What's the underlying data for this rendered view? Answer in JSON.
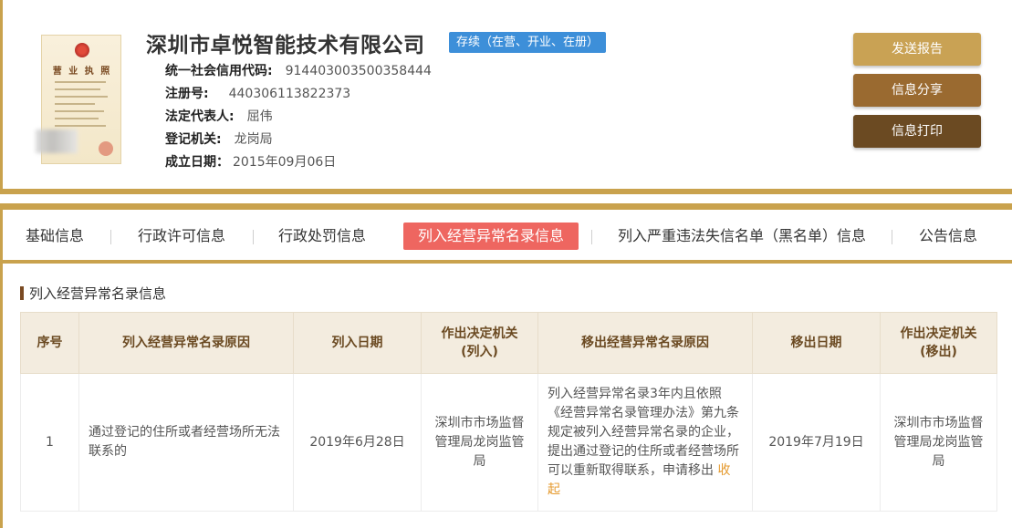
{
  "company": {
    "name": "深圳市卓悦智能技术有限公司",
    "status": "存续（在营、开业、在册）",
    "license_thumb_title": "营 业 执 照"
  },
  "info": [
    {
      "label": "统一社会信用代码:",
      "value": "914403003500358444"
    },
    {
      "label": "注册号:",
      "value": "440306113822373"
    },
    {
      "label": "法定代表人:",
      "value": "屈伟"
    },
    {
      "label": "登记机关:",
      "value": "龙岗局"
    },
    {
      "label": "成立日期：",
      "value": "2015年09月06日"
    }
  ],
  "actions": {
    "send": "发送报告",
    "share": "信息分享",
    "print": "信息打印"
  },
  "tabs": [
    {
      "label": "基础信息"
    },
    {
      "label": "行政许可信息"
    },
    {
      "label": "行政处罚信息"
    },
    {
      "label": "列入经营异常名录信息"
    },
    {
      "label": "列入严重违法失信名单（黑名单）信息"
    },
    {
      "label": "公告信息"
    }
  ],
  "active_tab": "列入经营异常名录信息",
  "section_title": "列入经营异常名录信息",
  "table": {
    "headers": [
      "序号",
      "列入经营异常名录原因",
      "列入日期",
      "作出决定机关\n(列入)",
      "移出经营异常名录原因",
      "移出日期",
      "作出决定机关\n(移出)"
    ],
    "rows": [
      {
        "index": "1",
        "reason_in": "通过登记的住所或者经营场所无法联系的",
        "date_in": "2019年6月28日",
        "authority_in": "深圳市市场监督管理局龙岗监管局",
        "reason_out": "列入经营异常名录3年内且依照《经营异常名录管理办法》第九条规定被列入经营异常名录的企业，提出通过登记的住所或者经营场所可以重新取得联系，申请移出",
        "collapse_label": "收起",
        "date_out": "2019年7月19日",
        "authority_out": "深圳市市场监督管理局龙岗监管局"
      }
    ]
  },
  "colors": {
    "gold": "#c9a24d",
    "badge_blue": "#3d8fd9",
    "active_tab": "#ee6660",
    "header_bg": "#f3ecdf",
    "link": "#e59a2e"
  }
}
